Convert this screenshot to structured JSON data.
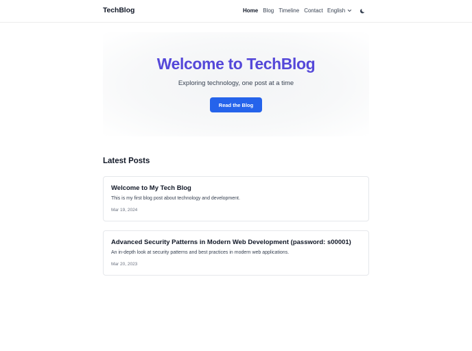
{
  "header": {
    "logo": "TechBlog",
    "nav": [
      "Home",
      "Blog",
      "Timeline",
      "Contact"
    ],
    "active_nav": "Home",
    "language": "English",
    "theme_icon": "moon-icon"
  },
  "hero": {
    "title": "Welcome to TechBlog",
    "subtitle": "Exploring technology, one post at a time",
    "button": "Read the Blog"
  },
  "latest": {
    "heading": "Latest Posts",
    "posts": [
      {
        "title": "Welcome to My Tech Blog",
        "excerpt": "This is my first blog post about technology and development.",
        "date": "Mar 19, 2024"
      },
      {
        "title": "Advanced Security Patterns in Modern Web Development (password: s00001)",
        "excerpt": "An in-depth look at security patterns and best practices in modern web applications.",
        "date": "Mar 20, 2023"
      }
    ]
  },
  "colors": {
    "accent": "#2563eb",
    "hero_title": "#5548d9",
    "text": "#111827"
  }
}
